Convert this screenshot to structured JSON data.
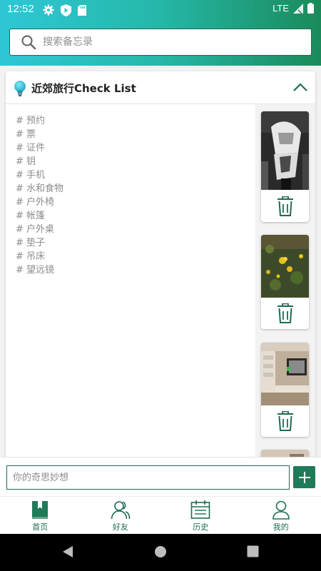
{
  "status_bar": {
    "time": "12:52",
    "network": "LTE"
  },
  "search": {
    "placeholder": "搜索备忘录"
  },
  "card": {
    "title": "近郊旅行Check List",
    "tags": [
      "# 预约",
      "# 票",
      "# 证件",
      "# 钥",
      "# 手机",
      "# 水和食物",
      "# 户外椅",
      "# 帐篷",
      "# 户外桌",
      "# 垫子",
      "# 吊床",
      "# 望远镜"
    ]
  },
  "input": {
    "placeholder": "你的奇思妙想"
  },
  "bottom_nav": [
    {
      "label": "首页",
      "icon": "book-icon"
    },
    {
      "label": "好友",
      "icon": "friends-icon"
    },
    {
      "label": "历史",
      "icon": "calendar-icon"
    },
    {
      "label": "我的",
      "icon": "person-icon"
    }
  ],
  "colors": {
    "accent": "#1e6b52",
    "header_start": "#2fc7d6",
    "header_end": "#1a8a5a"
  }
}
